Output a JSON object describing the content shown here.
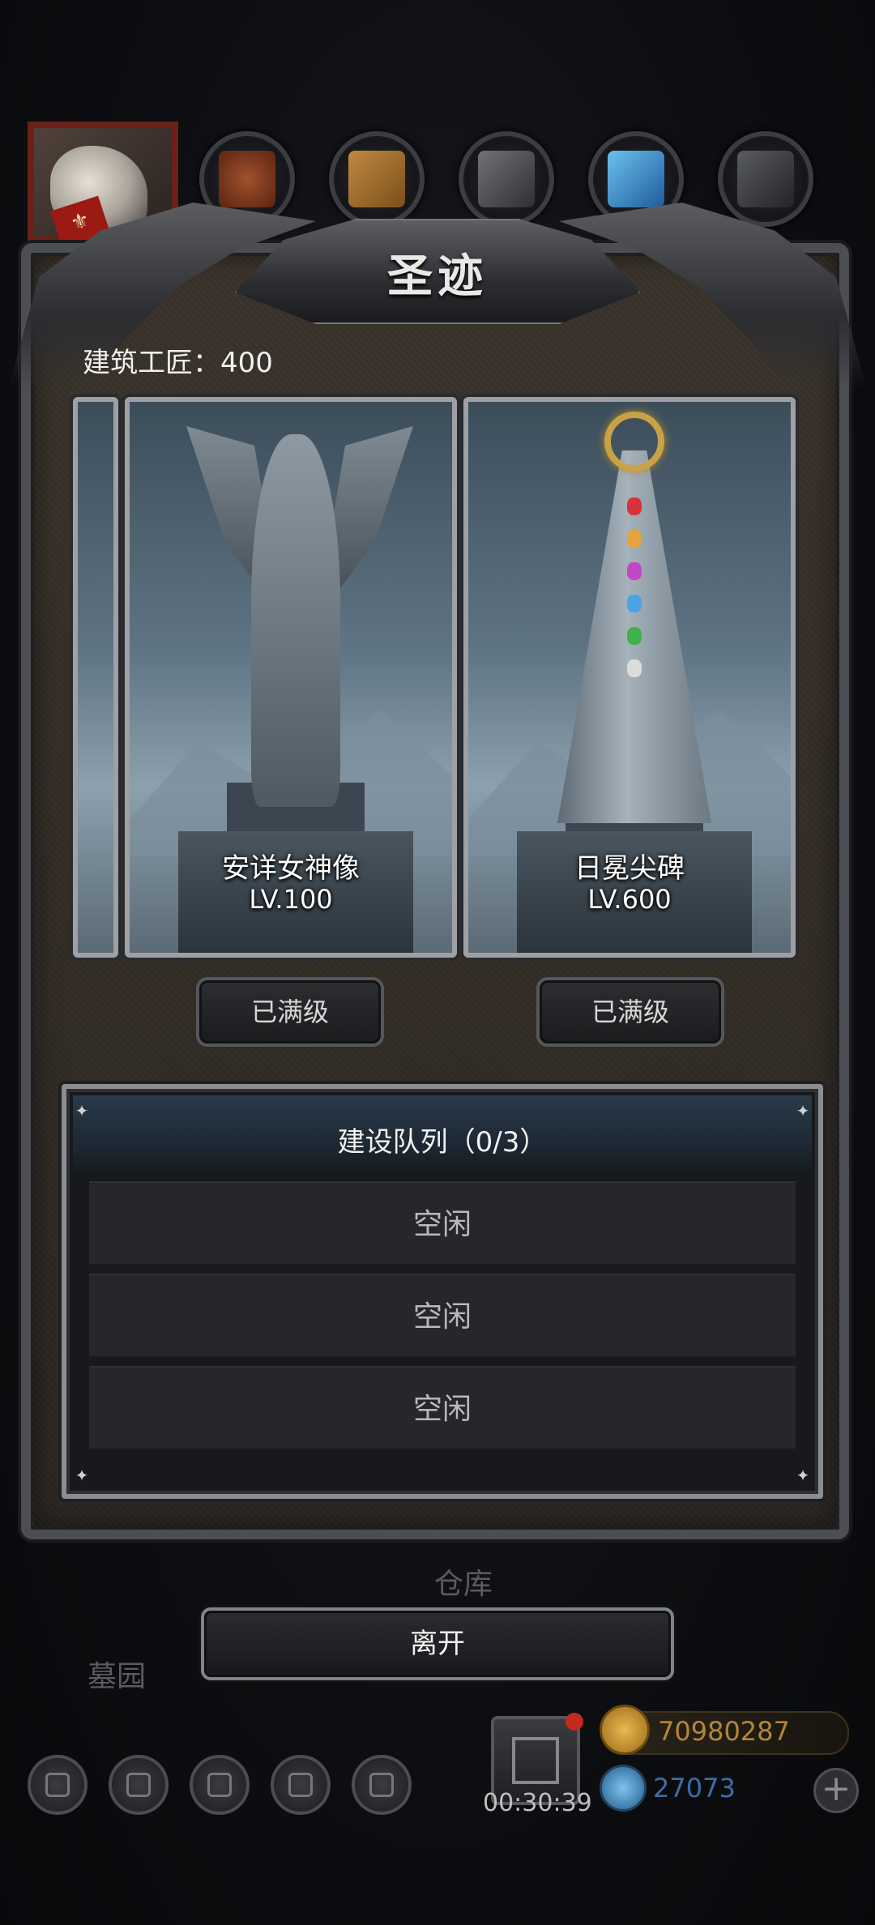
{
  "dialog": {
    "title": "圣迹",
    "builder_text": "建筑工匠：400",
    "leave_label": "离开"
  },
  "buildings": [
    {
      "name": "安详女神像",
      "level": "LV.100",
      "button_label": "已满级"
    },
    {
      "name": "日冕尖碑",
      "level": "LV.600",
      "button_label": "已满级"
    }
  ],
  "queue": {
    "title": "建设队列（0/3）",
    "slots": [
      "空闲",
      "空闲",
      "空闲"
    ]
  },
  "scene": {
    "warehouse_label": "仓库",
    "cemetery_label": "墓园"
  },
  "bottom_bar": {
    "timer": "00:30:39",
    "gold": "70980287",
    "gems": "27073",
    "plus_icon": "+"
  },
  "colors": {
    "dialog_bg": "#332d26",
    "frame_metal": "#9ea0a4",
    "gold_text": "#b4853a",
    "gem_text": "#3a6ea8",
    "notification_dot": "#c42a1d"
  },
  "icons": [
    "horse-avatar-icon",
    "meat-resource-icon",
    "wood-resource-icon",
    "stone-resource-icon",
    "crystal-resource-icon",
    "iron-resource-icon",
    "gift-icon",
    "gold-coin-icon",
    "gem-icon",
    "plus-icon",
    "settings-icon",
    "star-icon",
    "rank-icon",
    "mail-icon",
    "battle-icon"
  ]
}
